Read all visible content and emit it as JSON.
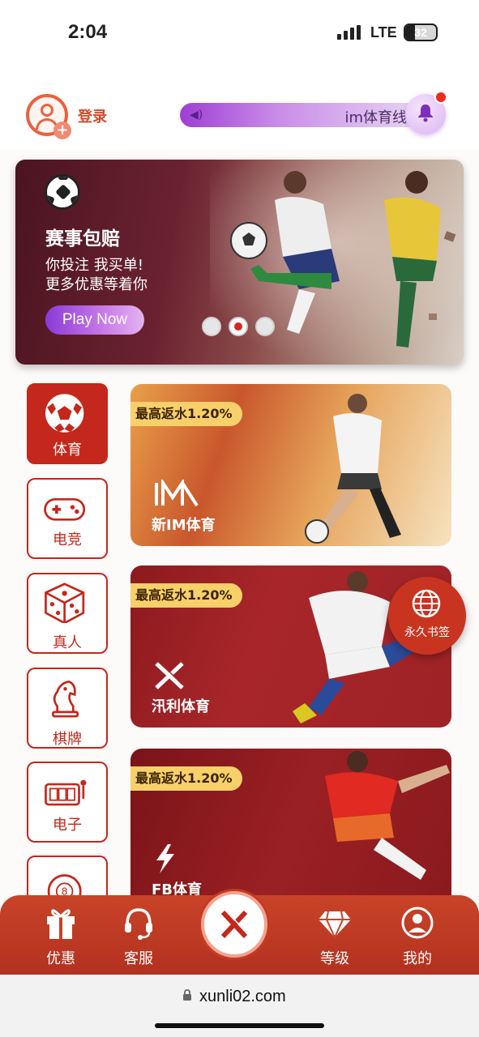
{
  "status_bar": {
    "time": "2:04",
    "network": "LTE",
    "battery": "32",
    "battery_level": 0.32
  },
  "header": {
    "login_label": "登录",
    "marquee_text": "im体育线",
    "avatar_icon": "user-add-icon",
    "speaker_icon": "speaker-icon",
    "bell_icon": "bell-icon"
  },
  "banner": {
    "title": "赛事包赔",
    "line1": "你投注 我买单!",
    "line2": "更多优惠等着你",
    "cta": "Play Now",
    "dots": 3,
    "active_dot": 1
  },
  "categories": [
    {
      "label": "体育",
      "icon": "soccer-ball-icon",
      "active": true
    },
    {
      "label": "电竞",
      "icon": "gamepad-icon",
      "active": false
    },
    {
      "label": "真人",
      "icon": "dice-icon",
      "active": false
    },
    {
      "label": "棋牌",
      "icon": "chess-knight-icon",
      "active": false
    },
    {
      "label": "电子",
      "icon": "slot-machine-icon",
      "active": false
    },
    {
      "label": "",
      "icon": "lottery-ball-icon",
      "active": false
    }
  ],
  "cards": [
    {
      "rebate": "最高返水1.20%",
      "name": "新IM体育",
      "logo": "im-logo"
    },
    {
      "rebate": "最高返水1.20%",
      "name": "汛利体育",
      "logo": "x-logo"
    },
    {
      "rebate": "最高返水1.20%",
      "name": "FB体育",
      "logo": "fb-lightning-logo"
    }
  ],
  "bookmark": {
    "label": "永久书签",
    "icon": "globe-icon"
  },
  "bottom_nav": [
    {
      "label": "优惠",
      "icon": "gift-icon"
    },
    {
      "label": "客服",
      "icon": "headset-icon"
    },
    {
      "label": "",
      "icon": "x-brand-icon"
    },
    {
      "label": "等级",
      "icon": "diamond-icon"
    },
    {
      "label": "我的",
      "icon": "profile-icon"
    }
  ],
  "browser": {
    "url": "xunli02.com"
  },
  "colors": {
    "brand_red": "#c4271b",
    "nav_red": "#c94328",
    "rebate_gold": "#f7d06a",
    "accent_purple": "#9d3fd4"
  }
}
